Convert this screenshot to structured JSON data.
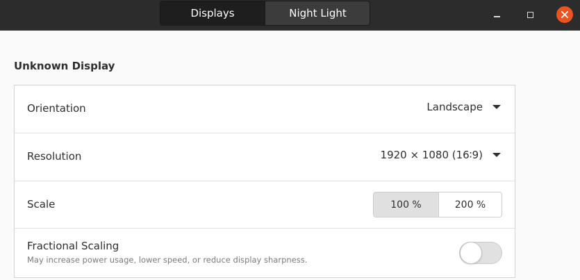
{
  "header": {
    "tabs": [
      {
        "label": "Displays",
        "active": true
      },
      {
        "label": "Night Light",
        "active": false
      }
    ],
    "window_controls": {
      "minimize_icon": "minimize-icon",
      "maximize_icon": "maximize-icon",
      "close_icon": "close-icon",
      "close_color": "#e95420"
    }
  },
  "section": {
    "title": "Unknown Display"
  },
  "settings": {
    "orientation": {
      "label": "Orientation",
      "value": "Landscape"
    },
    "resolution": {
      "label": "Resolution",
      "value": "1920 × 1080 (16∶9)"
    },
    "scale": {
      "label": "Scale",
      "options": [
        "100 %",
        "200 %"
      ],
      "selected": "100 %"
    },
    "fractional_scaling": {
      "label": "Fractional Scaling",
      "description": "May increase power usage, lower speed, or reduce display sharpness.",
      "enabled": false
    }
  }
}
